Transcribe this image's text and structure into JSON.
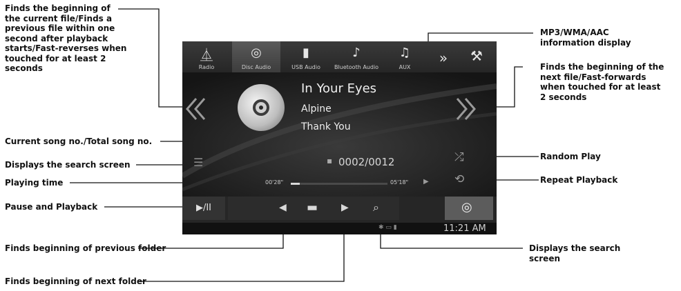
{
  "callouts": {
    "prev_file": "Finds the beginning of\nthe current file/Finds a\nprevious file within one\nsecond after playback\nstarts/Fast-reverses when\ntouched for at least 2\nseconds",
    "info_display": "MP3/WMA/AAC\ninformation display",
    "next_file": "Finds the beginning of the\nnext file/Fast-forwards\nwhen touched for at least\n2 seconds",
    "song_no": "Current song no./Total song no.",
    "search_screen_left": "Displays the search screen",
    "playing_time": "Playing time",
    "pause_play": "Pause and Playback",
    "random_play": "Random Play",
    "repeat_playback": "Repeat Playback",
    "prev_folder": "Finds beginning of previous folder",
    "search_screen_right": "Displays the search\nscreen",
    "next_folder": "Finds beginning of next folder"
  },
  "screen": {
    "tabs": [
      {
        "label": "Radio",
        "icon": "radio-tower-icon"
      },
      {
        "label": "Disc Audio",
        "icon": "disc-icon"
      },
      {
        "label": "USB Audio",
        "icon": "usb-icon"
      },
      {
        "label": "Bluetooth Audio",
        "icon": "bluetooth-music-icon"
      },
      {
        "label": "AUX",
        "icon": "aux-plug-icon"
      }
    ],
    "track": {
      "title": "In Your Eyes",
      "artist": "Alpine",
      "album": "Thank You"
    },
    "song_counter": "0002/0012",
    "elapsed": "00'28\"",
    "total": "05'18\"",
    "progress": 0.09,
    "clock": "11:21 AM",
    "play_pause_label": "▶/II"
  },
  "colors": {
    "screen_bg": "#1e1e1e",
    "bar_bg": "#262626",
    "text_light": "#efefef",
    "callout_line": "#111111"
  }
}
